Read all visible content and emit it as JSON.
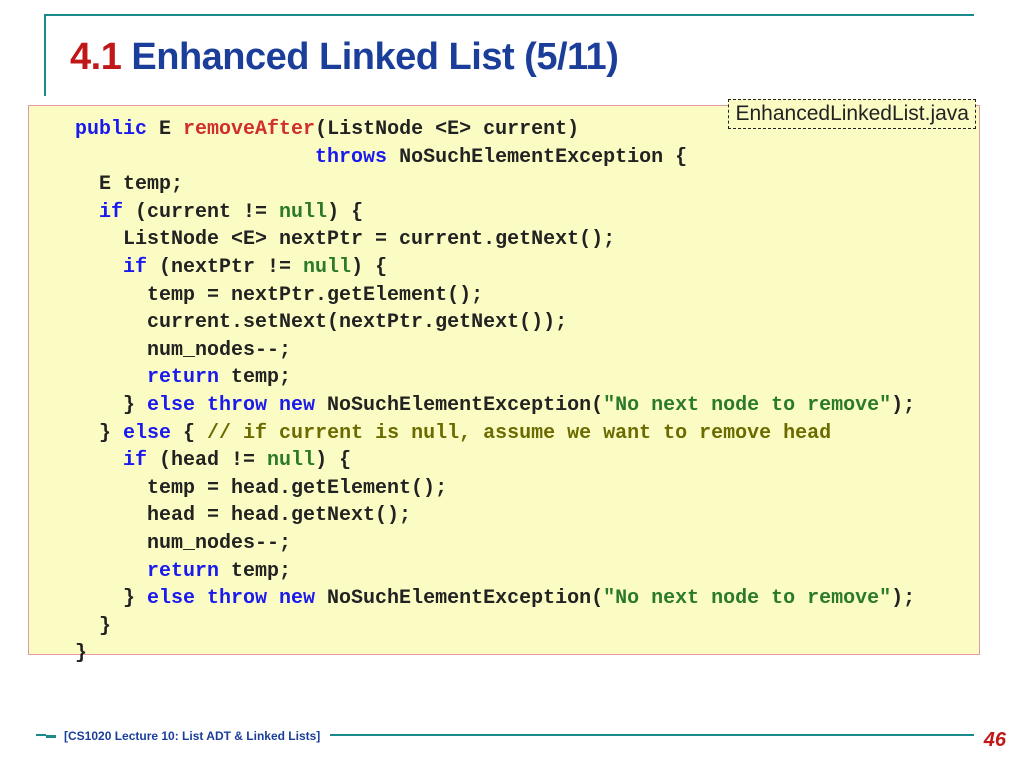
{
  "title": {
    "num": "4.1",
    "text": " Enhanced Linked List (5/11)"
  },
  "filename": "EnhancedLinkedList.java",
  "code": {
    "l1a": "  public",
    "l1b": " E ",
    "l1c": "removeAfter",
    "l1d": "(ListNode <E> current)",
    "l2a": "                      throws",
    "l2b": " NoSuchElementException {",
    "l3": "    E temp;",
    "l4a": "    if",
    "l4b": " (current != ",
    "l4c": "null",
    "l4d": ") {",
    "l5": "      ListNode <E> nextPtr = current.getNext();",
    "l6a": "      if",
    "l6b": " (nextPtr != ",
    "l6c": "null",
    "l6d": ") {",
    "l7": "        temp = nextPtr.getElement();",
    "l8": "        current.setNext(nextPtr.getNext());",
    "l9": "        num_nodes--;",
    "l10a": "        return",
    "l10b": " temp;",
    "l11a": "      } ",
    "l11b": "else throw new",
    "l11c": " NoSuchElementException(",
    "l11d": "\"No next node to remove\"",
    "l11e": ");",
    "l12a": "    } ",
    "l12b": "else",
    "l12c": " { ",
    "l12d": "// if current is null, assume we want to remove head",
    "l13a": "      if",
    "l13b": " (head != ",
    "l13c": "null",
    "l13d": ") {",
    "l14": "        temp = head.getElement();",
    "l15": "        head = head.getNext();",
    "l16": "        num_nodes--;",
    "l17a": "        return",
    "l17b": " temp;",
    "l18a": "      } ",
    "l18b": "else throw new",
    "l18c": " NoSuchElementException(",
    "l18d": "\"No next node to remove\"",
    "l18e": ");",
    "l19": "    }",
    "l20": "  }"
  },
  "footer": "[CS1020 Lecture 10: List ADT & Linked Lists]",
  "page": "46"
}
